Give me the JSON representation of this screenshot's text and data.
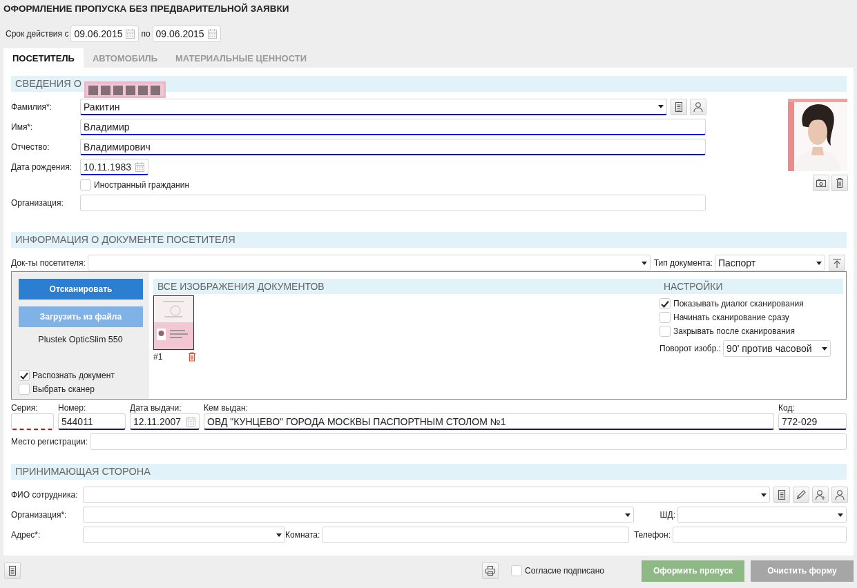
{
  "title": "ОФОРМЛЕНИЕ ПРОПУСКА БЕЗ ПРЕДВАРИТЕЛЬНОЙ ЗАЯВКИ",
  "validity": {
    "from_label": "Срок действия с",
    "from": "09.06.2015",
    "to_label": "по",
    "to": "09.06.2015"
  },
  "tabs": [
    {
      "label": "ПОСЕТИТЕЛЬ",
      "selected": true
    },
    {
      "label": "АВТОМОБИЛЬ",
      "selected": false
    },
    {
      "label": "МАТЕРИАЛЬНЫЕ ЦЕННОСТИ",
      "selected": false
    }
  ],
  "visitor": {
    "header": "СВЕДЕНИЯ О",
    "fields": [
      {
        "kind": "select",
        "label": "Фамилия*:",
        "value": "Ракитин",
        "highlighted": true,
        "invalid": false
      },
      {
        "kind": "text",
        "label": "Имя*:",
        "value": "Владимир",
        "highlighted": true,
        "invalid": false
      },
      {
        "kind": "text",
        "label": "Отчество:",
        "value": "Владимирович",
        "highlighted": true,
        "invalid": false
      },
      {
        "kind": "date",
        "label": "Дата рождения:",
        "value": "10.11.1983",
        "highlighted": true,
        "invalid": false
      },
      {
        "kind": "checkbox",
        "label": "Иностранный гражданин",
        "checked": false
      },
      {
        "kind": "text",
        "label": "Организация:",
        "highlighted": false,
        "invalid": false
      }
    ]
  },
  "documents": {
    "header": "ИНФОРМАЦИЯ О ДОКУМЕНТЕ ПОСЕТИТЕЛЯ",
    "docs_label": "Док-ты посетителя:",
    "type_label": "Тип документа:",
    "type_value": "Паспорт",
    "scan_button": {
      "label": "Отсканировать",
      "disabled": false
    },
    "upload_button": {
      "label": "Загрузить из файла",
      "disabled": true
    },
    "scanner_name": "Plustek OpticSlim 550",
    "options": [
      {
        "label": "Распознать документ",
        "checked": true
      },
      {
        "label": "Выбрать сканер",
        "checked": false
      }
    ],
    "images_header": "ВСЕ ИЗОБРАЖЕНИЯ ДОКУМЕНТОВ",
    "images": [
      {
        "caption": "#1"
      }
    ],
    "settings_header": "НАСТРОЙКИ",
    "settings": [
      {
        "label": "Показывать диалог сканирования",
        "checked": true
      },
      {
        "label": "Начинать сканирование сразу",
        "checked": false
      },
      {
        "label": "Закрывать после сканирования",
        "checked": false
      }
    ],
    "rotation_label": "Поворот изобр.:",
    "rotation_value": "90' против часовой",
    "fields": [
      {
        "kind": "text",
        "label": "Серия:",
        "highlighted": false,
        "invalid": true
      },
      {
        "kind": "text",
        "label": "Номер:",
        "value": "544011",
        "highlighted": true,
        "invalid": false
      },
      {
        "kind": "date",
        "label": "Дата выдачи:",
        "value": "12.11.2007",
        "highlighted": true,
        "invalid": false
      },
      {
        "kind": "text",
        "label": "Кем выдан:",
        "value": "ОВД \"КУНЦЕВО\" ГОРОДА МОСКВЫ ПАСПОРТНЫМ СТОЛОМ №1",
        "highlighted": true,
        "invalid": false
      },
      {
        "kind": "text",
        "label": "Код:",
        "value": "772-029",
        "highlighted": true,
        "invalid": false
      }
    ],
    "registration_label": "Место регистрации:"
  },
  "host": {
    "header": "ПРИНИМАЮЩАЯ СТОРОНА",
    "employee_label": "ФИО сотрудника:",
    "organization_label": "Организация*:",
    "sd_label": "ШД:",
    "address_label": "Адрес*:",
    "room_label": "Комната:",
    "phone_label": "Телефон:"
  },
  "footer": {
    "consent": {
      "label": "Согласие подписано",
      "checked": false
    },
    "buttons": [
      {
        "label": "Оформить пропуск",
        "kind": "primary",
        "disabled": true
      },
      {
        "label": "Очистить форму",
        "kind": "secondary",
        "disabled": false
      }
    ]
  }
}
